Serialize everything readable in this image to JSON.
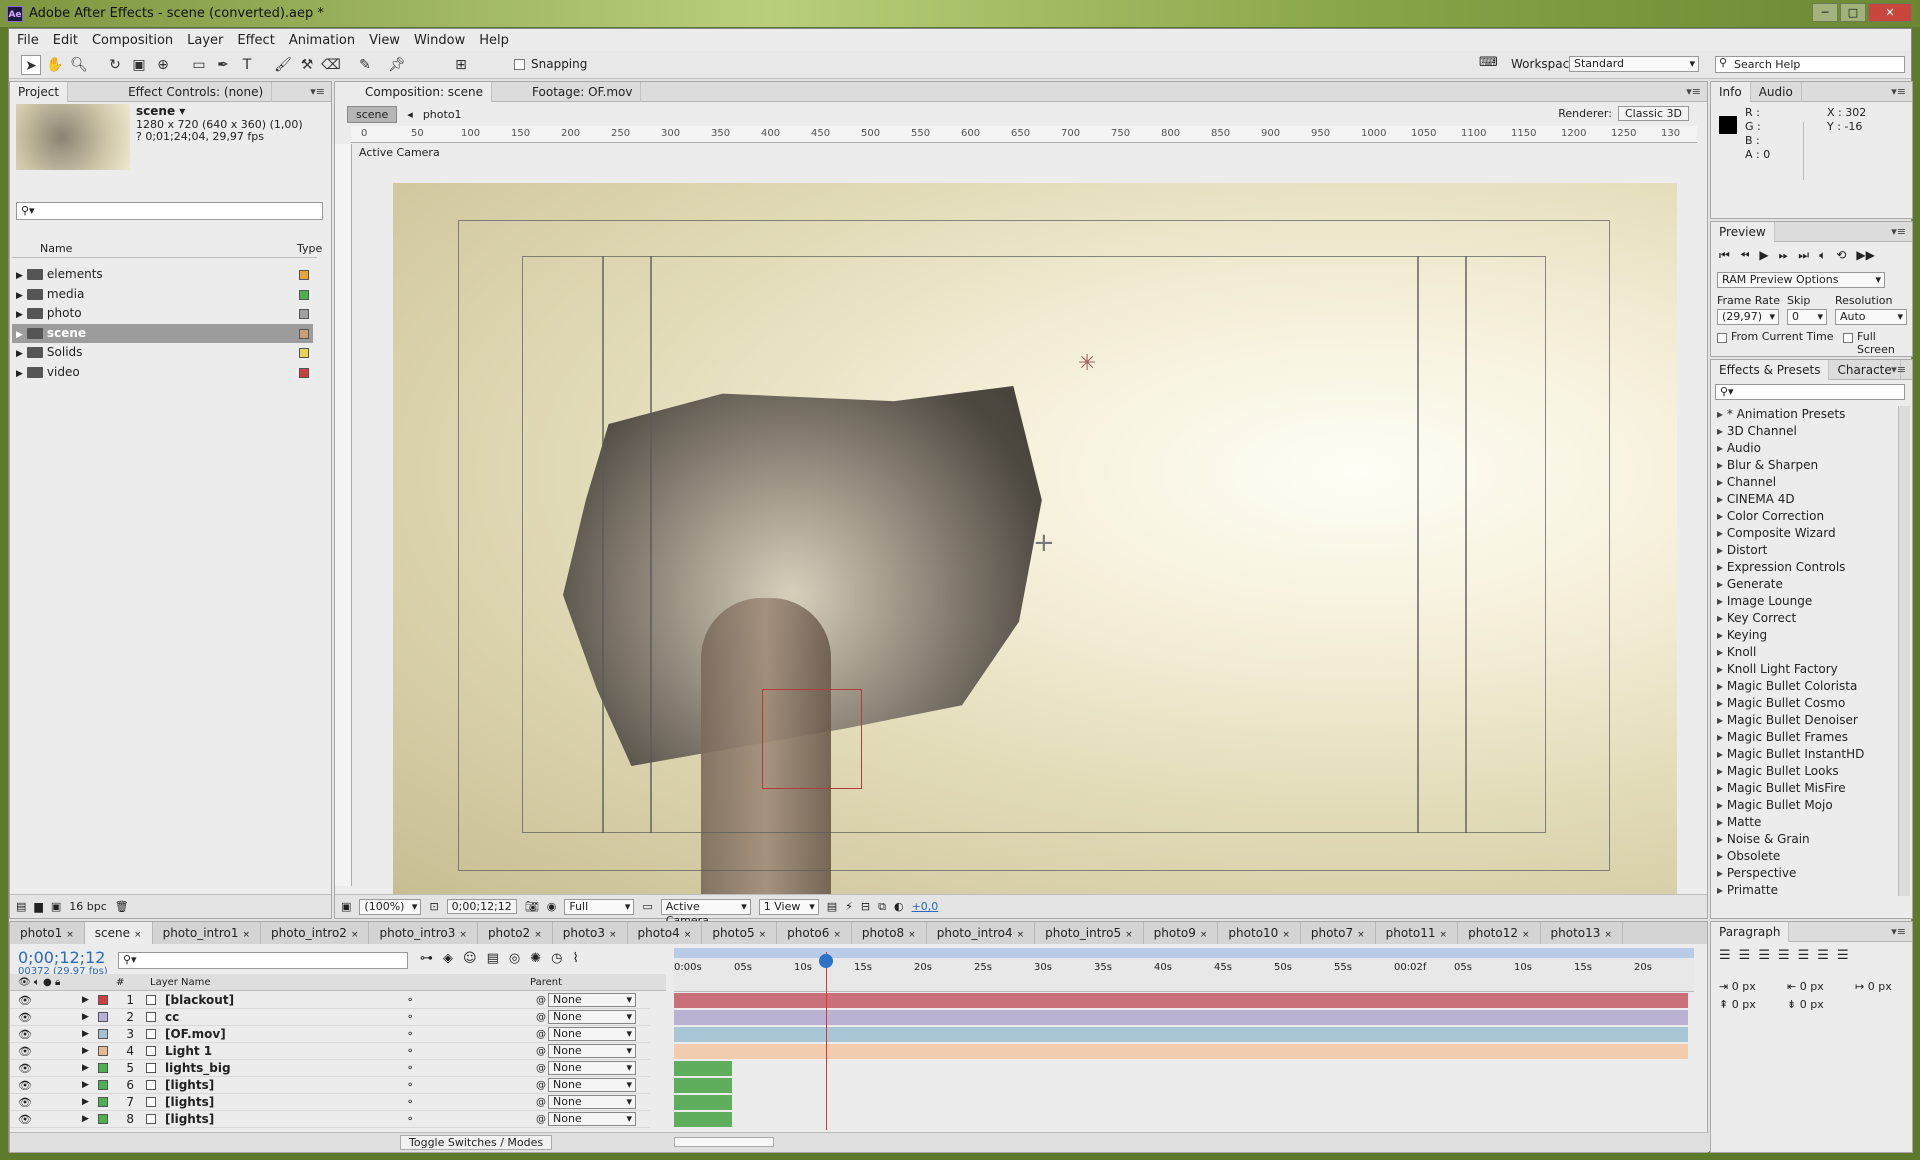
{
  "title": "Adobe After Effects - scene (converted).aep *",
  "menu": [
    "File",
    "Edit",
    "Composition",
    "Layer",
    "Effect",
    "Animation",
    "View",
    "Window",
    "Help"
  ],
  "toolbar": {
    "snapping": "Snapping",
    "workspace_label": "Workspace:",
    "workspace": "Standard",
    "search_placeholder": "Search Help"
  },
  "project": {
    "tabs": [
      "Project",
      "Effect Controls: (none)"
    ],
    "item_name": "scene ▾",
    "item_info1": "1280 x 720  (640 x 360) (1,00)",
    "item_info2": "? 0;01;24;04, 29,97 fps",
    "col_name": "Name",
    "col_type": "Type",
    "items": [
      {
        "name": "elements",
        "color": "#e5a33a"
      },
      {
        "name": "media",
        "color": "#4caf50"
      },
      {
        "name": "photo",
        "color": "#a0a0a0"
      },
      {
        "name": "scene",
        "color": "#c8a07a"
      },
      {
        "name": "Solids",
        "color": "#e6d45a"
      },
      {
        "name": "video",
        "color": "#c9413c"
      }
    ],
    "bpc": "16 bpc"
  },
  "composition": {
    "tabs": [
      "Composition: scene",
      "Footage: OF.mov"
    ],
    "crumbs": [
      "scene",
      "photo1"
    ],
    "renderer_label": "Renderer:",
    "renderer": "Classic 3D",
    "camera_label": "Active Camera",
    "ruler_ticks": [
      "0",
      "50",
      "100",
      "150",
      "200",
      "250",
      "300",
      "350",
      "400",
      "450",
      "500",
      "550",
      "600",
      "650",
      "700",
      "750",
      "800",
      "850",
      "900",
      "950",
      "1000",
      "1050",
      "1100",
      "1150",
      "1200",
      "1250",
      "130"
    ],
    "zoom": "(100%)",
    "timecode": "0;00;12;12",
    "quality": "Full",
    "view_cam": "Active Camera",
    "views": "1 View",
    "exposure": "+0,0"
  },
  "info": {
    "tabs": [
      "Info",
      "Audio"
    ],
    "r": "R :",
    "g": "G :",
    "b": "B :",
    "a": "A :  0",
    "x": "X : 302",
    "y": "Y : -16"
  },
  "preview": {
    "tab": "Preview",
    "options": "RAM Preview Options",
    "frame_rate_label": "Frame Rate",
    "skip_label": "Skip",
    "resolution_label": "Resolution",
    "frame_rate": "(29,97)",
    "skip": "0",
    "resolution": "Auto",
    "from_current": "From Current Time",
    "full_screen": "Full Screen"
  },
  "effects": {
    "tabs": [
      "Effects & Presets",
      "Characte"
    ],
    "items": [
      "* Animation Presets",
      "3D Channel",
      "Audio",
      "Blur & Sharpen",
      "Channel",
      "CINEMA 4D",
      "Color Correction",
      "Composite Wizard",
      "Distort",
      "Expression Controls",
      "Generate",
      "Image Lounge",
      "Key Correct",
      "Keying",
      "Knoll",
      "Knoll Light Factory",
      "Magic Bullet Colorista",
      "Magic Bullet Cosmo",
      "Magic Bullet Denoiser",
      "Magic Bullet Frames",
      "Magic Bullet InstantHD",
      "Magic Bullet Looks",
      "Magic Bullet MisFire",
      "Magic Bullet Mojo",
      "Matte",
      "Noise & Grain",
      "Obsolete",
      "Perspective",
      "Primatte"
    ]
  },
  "paragraph": {
    "tab": "Paragraph",
    "v1": "0 px",
    "v2": "0 px",
    "v3": "0 px",
    "v4": "0 px",
    "v5": "0 px"
  },
  "timeline": {
    "tabs": [
      "photo1",
      "scene",
      "photo_intro1",
      "photo_intro2",
      "photo_intro3",
      "photo2",
      "photo3",
      "photo4",
      "photo5",
      "photo6",
      "photo8",
      "photo_intro4",
      "photo_intro5",
      "photo9",
      "photo10",
      "photo7",
      "photo11",
      "photo12",
      "photo13"
    ],
    "timecode": "0;00;12;12",
    "fps": "00372 (29.97 fps)",
    "col_layer": "Layer Name",
    "col_parent": "Parent",
    "ticks": [
      "0:00s",
      "05s",
      "10s",
      "15s",
      "20s",
      "25s",
      "30s",
      "35s",
      "40s",
      "45s",
      "50s",
      "55s",
      "00:02f",
      "05s",
      "10s",
      "15s",
      "20s"
    ],
    "layers": [
      {
        "num": "1",
        "name": "[blackout]",
        "label": "#c9413c",
        "parent": "None",
        "bar": "#c9707a",
        "full": true
      },
      {
        "num": "2",
        "name": "cc",
        "label": "#b8b0d6",
        "parent": "None",
        "bar": "#b9b2d2",
        "full": true
      },
      {
        "num": "3",
        "name": "[OF.mov]",
        "label": "#a3c1d4",
        "parent": "None",
        "bar": "#a9c6d6",
        "full": true
      },
      {
        "num": "4",
        "name": "Light 1",
        "label": "#e8b98f",
        "parent": "None",
        "bar": "#f1ccae",
        "full": true
      },
      {
        "num": "5",
        "name": "lights_big",
        "label": "#4caf50",
        "parent": "None",
        "bar": "#5eae5e",
        "full": false
      },
      {
        "num": "6",
        "name": "[lights]",
        "label": "#4caf50",
        "parent": "None",
        "bar": "#5eae5e",
        "full": false
      },
      {
        "num": "7",
        "name": "[lights]",
        "label": "#4caf50",
        "parent": "None",
        "bar": "#5eae5e",
        "full": false
      },
      {
        "num": "8",
        "name": "[lights]",
        "label": "#4caf50",
        "parent": "None",
        "bar": "#5eae5e",
        "full": false
      }
    ],
    "toggle": "Toggle Switches / Modes"
  }
}
